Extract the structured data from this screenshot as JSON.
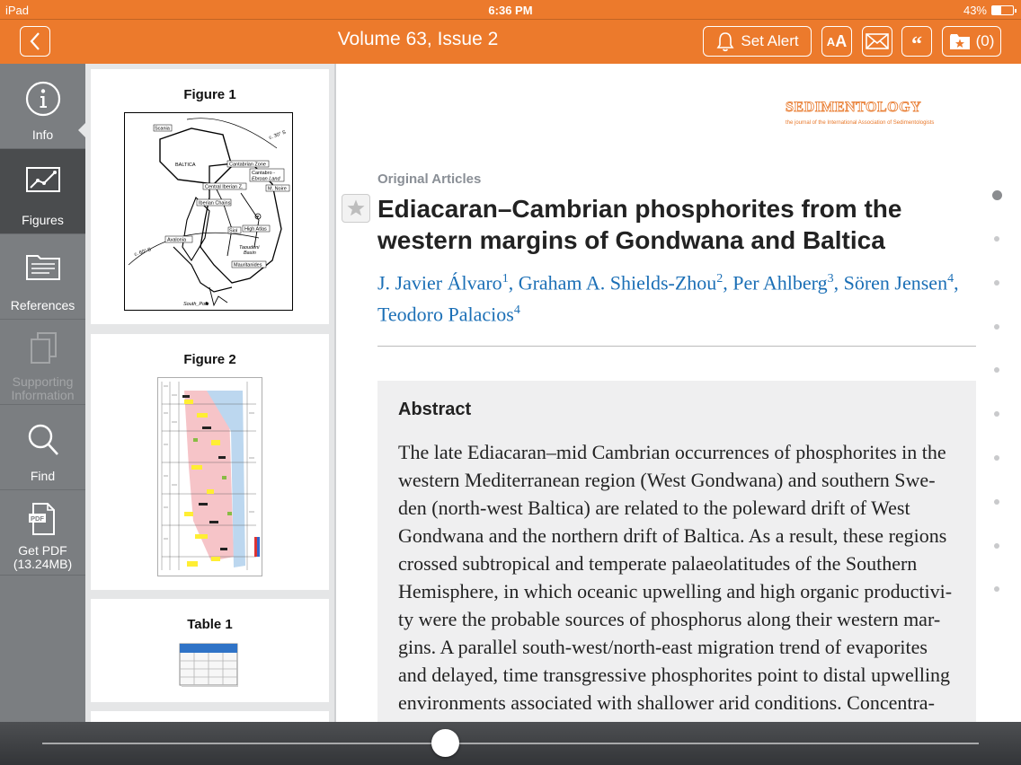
{
  "status_bar": {
    "carrier": "iPad",
    "time": "6:36 PM",
    "battery": "43%",
    "battery_level": 0.43
  },
  "toolbar": {
    "title": "Volume 63, Issue 2",
    "set_alert_label": "Set Alert",
    "font_size_label": "AA",
    "favorites_count_label": "(0)"
  },
  "nav": {
    "items": [
      {
        "label": "Info",
        "icon": "info-icon",
        "state": "normal"
      },
      {
        "label": "Figures",
        "icon": "chart-icon",
        "state": "active"
      },
      {
        "label": "References",
        "icon": "folder-icon",
        "state": "normal"
      },
      {
        "label": "Supporting Information",
        "icon": "copy-icon",
        "state": "disabled"
      },
      {
        "label": "Find",
        "icon": "search-icon",
        "state": "normal"
      },
      {
        "label": "Get PDF (13.24MB)",
        "icon": "pdf-icon",
        "state": "normal"
      }
    ],
    "labels": {
      "info": "Info",
      "figures": "Figures",
      "references": "References",
      "supporting_1": "Supporting",
      "supporting_2": "Information",
      "find": "Find",
      "pdf_1": "Get PDF",
      "pdf_2": "(13.24MB)"
    }
  },
  "figures_panel": {
    "cards": [
      {
        "caption": "Figure 1"
      },
      {
        "caption": "Figure 2"
      },
      {
        "caption": "Table 1"
      }
    ],
    "map_labels": {
      "scania": "Scania",
      "baltica": "BALTICA",
      "cantabrian": "Cantabrian Zone",
      "cantabro_1": "Cantabro -",
      "cantabro_2": "Ebroan Land",
      "central_iberian": "Central Iberian Z.",
      "m_noire": "M. Noire",
      "iberian_chains": "Iberian Chains",
      "high_atlas": "High Atlas",
      "siol": "Siol",
      "taoudeni_1": "Taoudeni",
      "taoudeni_2": "Basin",
      "avalonia": "Avalonia",
      "mauritanides": "Mauritanides",
      "lat_30": "c. 30° S",
      "lat_60": "c. 60° S",
      "south_pole": "South_Pole"
    }
  },
  "article": {
    "journal_name": "SEDIMENTOLOGY",
    "journal_sub": "the journal of the International Association of Sedimentologists",
    "section": "Original Articles",
    "title": "Ediacaran–Cambrian phosphorites from the western margins of Gondwana and Baltica",
    "authors": [
      {
        "name": "J. Javier Álvaro",
        "aff": "1"
      },
      {
        "name": "Graham A. Shields-Zhou",
        "aff": "2"
      },
      {
        "name": "Per Ahlberg",
        "aff": "3"
      },
      {
        "name": "Sören Jensen",
        "aff": "4"
      },
      {
        "name": "Teodoro Palacios",
        "aff": "4"
      }
    ],
    "abstract_heading": "Abstract",
    "abstract_lines": [
      "The late Ediacaran–mid Cambrian occurrences of phosphorites in the",
      "western Mediterranean region (West Gondwana) and southern Swe-",
      "den (north-west Baltica) are related to the poleward drift of West",
      "Gondwana and the northern drift of Baltica. As a result, these regions",
      "crossed subtropical and temperate palaeolatitudes of the Southern",
      "Hemisphere, in which oceanic upwelling and high organic productivi-",
      "ty were the probable sources of phosphorus along their western mar-",
      "gins. A parallel south-west/north-east migration trend of evaporites",
      "and delayed, time transgressive phosphorites point to distal upwelling",
      "environments associated with shallower arid conditions. Concentra-"
    ]
  },
  "page_indicator": {
    "pages": 10,
    "current": 1
  },
  "page_slider": {
    "position": 0.43
  },
  "colors": {
    "toolbar": "#ec7a2c",
    "nav": "#7b7e81",
    "nav_active": "#4a4c4e",
    "link": "#1b6fb6",
    "panel": "#e5e6e7"
  }
}
